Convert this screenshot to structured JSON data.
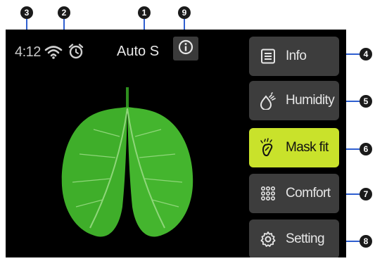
{
  "status": {
    "time": "4:12",
    "mode": "Auto S",
    "wifi_icon": "wifi-icon",
    "alarm_icon": "alarm-clock-icon",
    "info_icon": "info-circle-icon"
  },
  "menu": {
    "items": [
      {
        "label": "Info",
        "icon": "document-icon"
      },
      {
        "label": "Humidity",
        "icon": "humidity-drop-icon"
      },
      {
        "label": "Mask fit",
        "icon": "mask-icon",
        "active": true
      },
      {
        "label": "Comfort",
        "icon": "dots-grid-icon"
      },
      {
        "label": "Setting",
        "icon": "gear-icon"
      }
    ]
  },
  "callouts": [
    "1",
    "2",
    "3",
    "4",
    "5",
    "6",
    "7",
    "8",
    "9"
  ],
  "colors": {
    "screen_bg": "#000000",
    "button_bg": "#3d3d3d",
    "active_button_bg": "#c9e22b",
    "leaf_green": "#3fae2a",
    "callout_bg": "#1a1a1a",
    "leader_line": "#2f5fd0"
  },
  "illustration": {
    "name": "lung-leaves-illustration"
  }
}
